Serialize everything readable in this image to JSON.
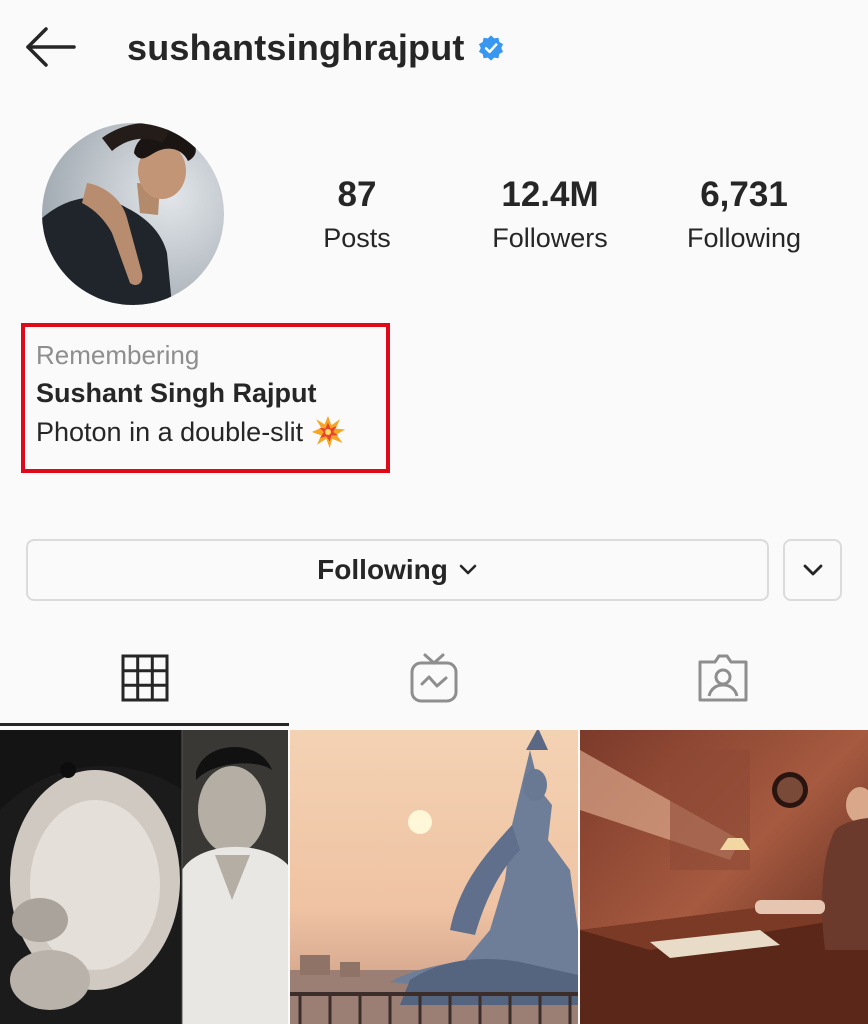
{
  "header": {
    "username": "sushantsinghrajput",
    "back_icon": "arrow-left-icon",
    "verified_icon": "verified-badge-icon"
  },
  "stats": [
    {
      "value": "87",
      "label": "Posts"
    },
    {
      "value": "12.4M",
      "label": "Followers"
    },
    {
      "value": "6,731",
      "label": "Following"
    }
  ],
  "bio": {
    "remembering": "Remembering",
    "name": "Sushant Singh Rajput",
    "text": "Photon in a double-slit",
    "emoji_icon": "collision-emoji-icon",
    "highlight_color": "#e0091a"
  },
  "actions": {
    "follow_label": "Following",
    "dropdown_icon": "chevron-down-icon"
  },
  "tabs": [
    {
      "icon": "grid-icon",
      "active": true
    },
    {
      "icon": "igtv-icon",
      "active": false
    },
    {
      "icon": "tagged-icon",
      "active": false
    }
  ],
  "colors": {
    "background": "#fafafa",
    "text": "#262626",
    "muted": "#8e8e8e",
    "verified": "#3897f0",
    "border": "#dbdbdb"
  }
}
